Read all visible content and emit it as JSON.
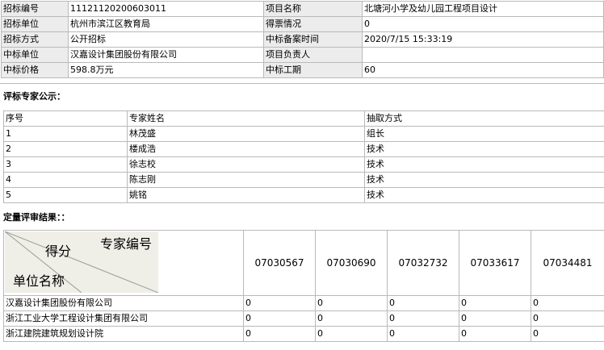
{
  "info": {
    "rows": [
      {
        "l1": "招标编号",
        "v1": "11121120200603011",
        "l2": "项目名称",
        "v2": "北塘河小学及幼儿园工程项目设计"
      },
      {
        "l1": "招标单位",
        "v1": "杭州市滨江区教育局",
        "l2": "得票情况",
        "v2": "0"
      },
      {
        "l1": "招标方式",
        "v1": "公开招标",
        "l2": "中标备案时间",
        "v2": "2020/7/15 15:33:19"
      },
      {
        "l1": "中标单位",
        "v1": "汉嘉设计集团股份有限公司",
        "l2": "项目负责人",
        "v2": ""
      },
      {
        "l1": "中标价格",
        "v1": "598.8万元",
        "l2": "中标工期",
        "v2": "60"
      }
    ]
  },
  "experts": {
    "title": "评标专家公示：",
    "headers": [
      "序号",
      "专家姓名",
      "抽取方式"
    ],
    "rows": [
      [
        "1",
        "林茂盛",
        "组长"
      ],
      [
        "2",
        "楼成浩",
        "技术"
      ],
      [
        "3",
        "徐志校",
        "技术"
      ],
      [
        "4",
        "陈志刚",
        "技术"
      ],
      [
        "5",
        "姚铭",
        "技术"
      ]
    ]
  },
  "results": {
    "title": "定量评审结果：：",
    "corner": {
      "top": "专家编号",
      "mid": "得分",
      "bottom": "单位名称"
    },
    "expert_ids": [
      "07030567",
      "07030690",
      "07032732",
      "07033617",
      "07034481"
    ],
    "rows": [
      {
        "name": "汉嘉设计集团股份有限公司",
        "scores": [
          "0",
          "0",
          "0",
          "0",
          "0"
        ]
      },
      {
        "name": "浙江工业大学工程设计集团有限公司",
        "scores": [
          "0",
          "0",
          "0",
          "0",
          "0"
        ]
      },
      {
        "name": "浙江建院建筑规划设计院",
        "scores": [
          "0",
          "0",
          "0",
          "0",
          "0"
        ]
      }
    ]
  }
}
